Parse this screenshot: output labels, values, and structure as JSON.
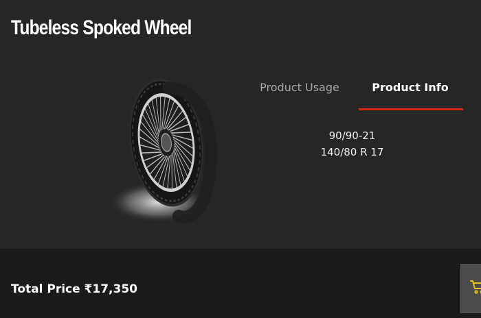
{
  "product": {
    "title": "Tubeless Spoked Wheel"
  },
  "tabs": [
    {
      "label": "Product Usage",
      "active": false
    },
    {
      "label": "Product Info",
      "active": true
    }
  ],
  "product_info": {
    "lines": [
      "90/90-21",
      "140/80 R 17"
    ]
  },
  "footer": {
    "total_label": "Total Price ₹17,350"
  },
  "icons": {
    "cart": "cart-icon",
    "wheel": "spoked-wheel-image"
  },
  "colors": {
    "accent": "#d3271a",
    "cart_icon": "#e8c11a",
    "background": "#262626",
    "footer": "#1b1b1b"
  }
}
